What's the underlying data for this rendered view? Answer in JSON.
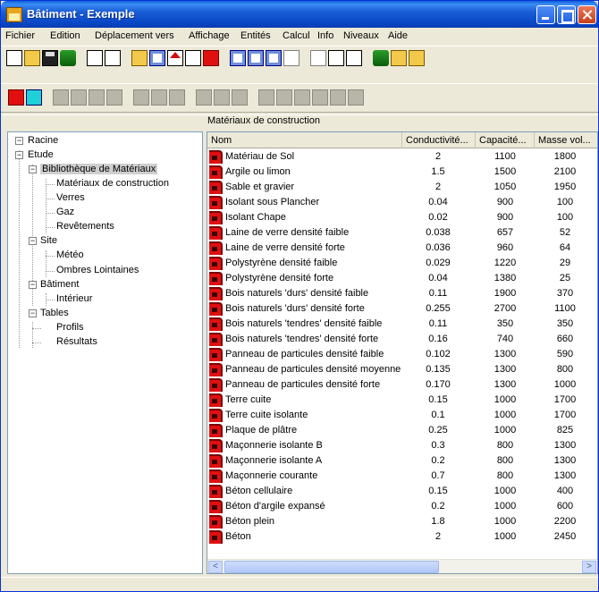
{
  "window": {
    "title": "Bâtiment - Exemple"
  },
  "menu": [
    "Fichier",
    "Edition",
    "Déplacement vers",
    "Affichage",
    "Entités",
    "Calcul",
    "Info",
    "Niveaux",
    "Aide"
  ],
  "tree": {
    "root": "Racine",
    "etude": "Etude",
    "bibliotheque": "Bibliothèque de Matériaux",
    "materiaux": "Matériaux de construction",
    "verres": "Verres",
    "gaz": "Gaz",
    "revetements": "Revêtements",
    "site": "Site",
    "meteo": "Météo",
    "ombres": "Ombres Lointaines",
    "batiment": "Bâtiment",
    "interieur": "Intérieur",
    "tables": "Tables",
    "profils": "Profils",
    "resultats": "Résultats"
  },
  "list": {
    "caption": "Matériaux de construction",
    "columns": [
      "Nom",
      "Conductivité...",
      "Capacité...",
      "Masse vol..."
    ],
    "rows": [
      [
        "Matériau de Sol",
        "2",
        "1100",
        "1800"
      ],
      [
        "Argile ou limon",
        "1.5",
        "1500",
        "2100"
      ],
      [
        "Sable et gravier",
        "2",
        "1050",
        "1950"
      ],
      [
        "Isolant sous Plancher",
        "0.04",
        "900",
        "100"
      ],
      [
        "Isolant Chape",
        "0.02",
        "900",
        "100"
      ],
      [
        "Laine de verre densité faible",
        "0.038",
        "657",
        "52"
      ],
      [
        "Laine de verre densité forte",
        "0.036",
        "960",
        "64"
      ],
      [
        "Polystyrène densité faible",
        "0.029",
        "1220",
        "29"
      ],
      [
        "Polystyrène densité forte",
        "0.04",
        "1380",
        "25"
      ],
      [
        "Bois naturels 'durs' densité faible",
        "0.11",
        "1900",
        "370"
      ],
      [
        "Bois naturels 'durs' densité forte",
        "0.255",
        "2700",
        "1100"
      ],
      [
        "Bois naturels 'tendres' densité faible",
        "0.11",
        "350",
        "350"
      ],
      [
        "Bois naturels 'tendres' densité forte",
        "0.16",
        "740",
        "660"
      ],
      [
        "Panneau de particules densité faible",
        "0.102",
        "1300",
        "590"
      ],
      [
        "Panneau de particules densité moyenne",
        "0.135",
        "1300",
        "800"
      ],
      [
        "Panneau de particules densité forte",
        "0.170",
        "1300",
        "1000"
      ],
      [
        "Terre cuite",
        "0.15",
        "1000",
        "1700"
      ],
      [
        "Terre cuite isolante",
        "0.1",
        "1000",
        "1700"
      ],
      [
        "Plaque de plâtre",
        "0.25",
        "1000",
        "825"
      ],
      [
        "Maçonnerie isolante B",
        "0.3",
        "800",
        "1300"
      ],
      [
        "Maçonnerie isolante A",
        "0.2",
        "800",
        "1300"
      ],
      [
        "Maçonnerie courante",
        "0.7",
        "800",
        "1300"
      ],
      [
        "Béton cellulaire",
        "0.15",
        "1000",
        "400"
      ],
      [
        "Béton d'argile expansé",
        "0.2",
        "1000",
        "600"
      ],
      [
        "Béton plein",
        "1.8",
        "1000",
        "2200"
      ],
      [
        "Béton",
        "2",
        "1000",
        "2450"
      ]
    ]
  },
  "scroll": {
    "left": "<",
    "right": ">"
  },
  "tree_expanders": {
    "expanded": "−"
  }
}
